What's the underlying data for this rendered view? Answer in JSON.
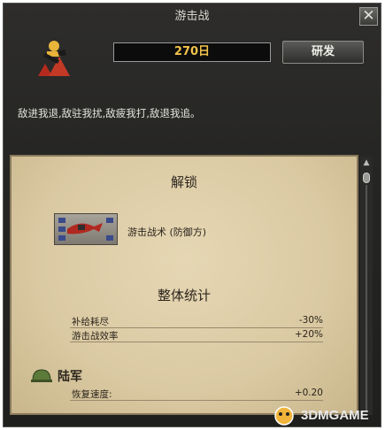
{
  "window": {
    "title": "游击战"
  },
  "header": {
    "days": "270日",
    "research_label": "研发",
    "description": "敌进我退,敌驻我扰,敌疲我打,敌退我追。"
  },
  "unlock": {
    "heading": "解锁",
    "item_label": "游击战术 (防御方)"
  },
  "stats": {
    "heading": "整体统计",
    "rows": [
      {
        "label": "补给耗尽",
        "value": "-30%"
      },
      {
        "label": "游击战效率",
        "value": "+20%"
      }
    ]
  },
  "army": {
    "heading": "陆军",
    "rows": [
      {
        "label": "恢复速度:",
        "value": "+0.20"
      }
    ]
  },
  "watermark": {
    "text": "3DMGAME"
  },
  "colors": {
    "accent_gold": "#f2c34a",
    "panel_parchment": "#dac9a2"
  }
}
